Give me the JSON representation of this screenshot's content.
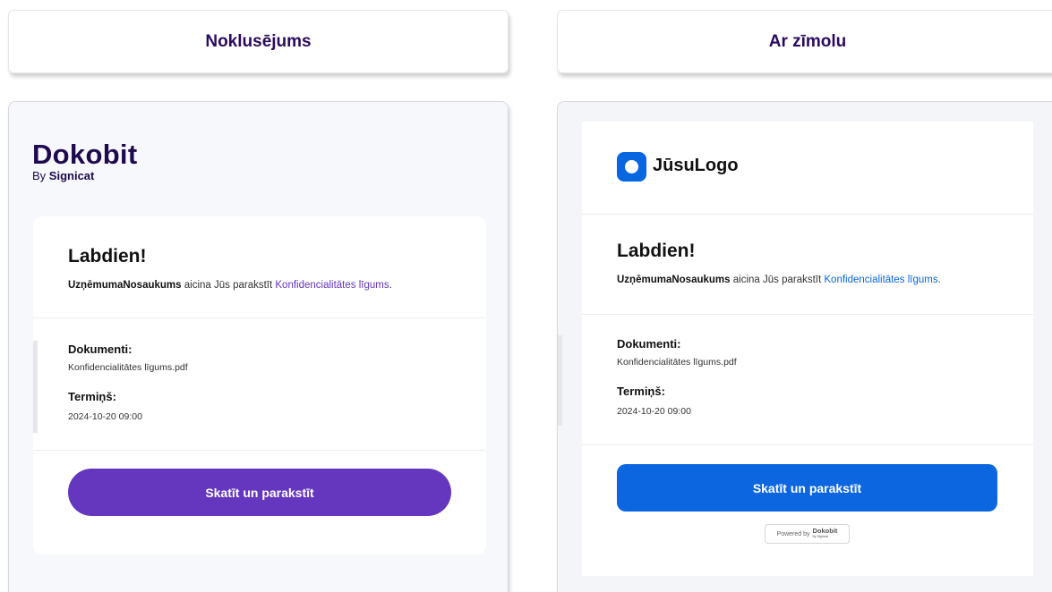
{
  "tabs": {
    "default_label": "Noklusējums",
    "branded_label": "Ar zīmolu"
  },
  "default_email": {
    "logo": {
      "word": "Dokobit",
      "by": "By",
      "company": "Signicat"
    },
    "greeting": "Labdien!",
    "company_name": "UzņēmumaNosaukums",
    "invite_text": " aicina Jūs parakstīt ",
    "document_link": "Konfidencialitātes līgums",
    "period": ".",
    "documents_label": "Dokumenti:",
    "document_file": "Konfidencialitātes līgums.pdf",
    "deadline_label": "Termiņš:",
    "deadline_value": "2024-10-20 09:00",
    "cta_label": "Skatīt un parakstīt",
    "accent_color": "#6536be"
  },
  "branded_email": {
    "logo_text": "JūsuLogo",
    "logo_icon": "rounded-square-circle-icon",
    "greeting": "Labdien!",
    "company_name": "UzņēmumaNosaukums",
    "invite_text": " aicina Jūs parakstīt ",
    "document_link": "Konfidencialitātes līgums",
    "period": ".",
    "documents_label": "Dokumenti:",
    "document_file": "Konfidencialitātes līgums.pdf",
    "deadline_label": "Termiņš:",
    "deadline_value": "2024-10-20 09:00",
    "cta_label": "Skatīt un parakstīt",
    "powered_by": "Powered by",
    "powered_logo": "Dokobit",
    "powered_logo_sub": "By Signicat",
    "accent_color": "#0b66e0"
  }
}
